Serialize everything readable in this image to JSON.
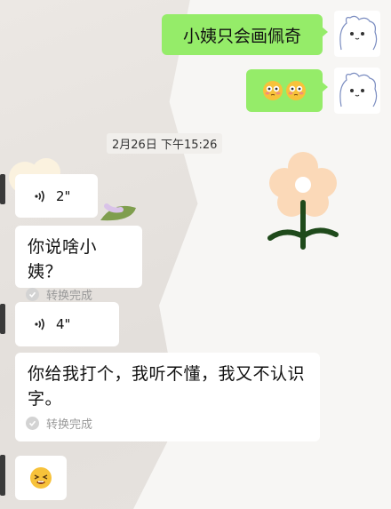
{
  "chat": {
    "outgoing_text": "小姨只会画佩奇",
    "outgoing_emoji_label": "😳😳",
    "timestamp": "2月26日 下午15:26",
    "voice_1_duration": "2\"",
    "voice_1_transcript": "你说啥小姨？",
    "voice_1_status": "转换完成",
    "voice_2_duration": "4\"",
    "voice_2_transcript": "你给我打个，我听不懂，我又不认识字。",
    "voice_2_status": "转换完成",
    "incoming_emoji_label": "😫"
  },
  "icons": {
    "voice": "voice-wave-icon",
    "check": "check-circle-icon",
    "avatar": "bear-drawing-avatar"
  },
  "colors": {
    "outgoing_bubble": "#95ec69",
    "incoming_bubble": "#ffffff",
    "status_text": "#9a9a9a"
  }
}
